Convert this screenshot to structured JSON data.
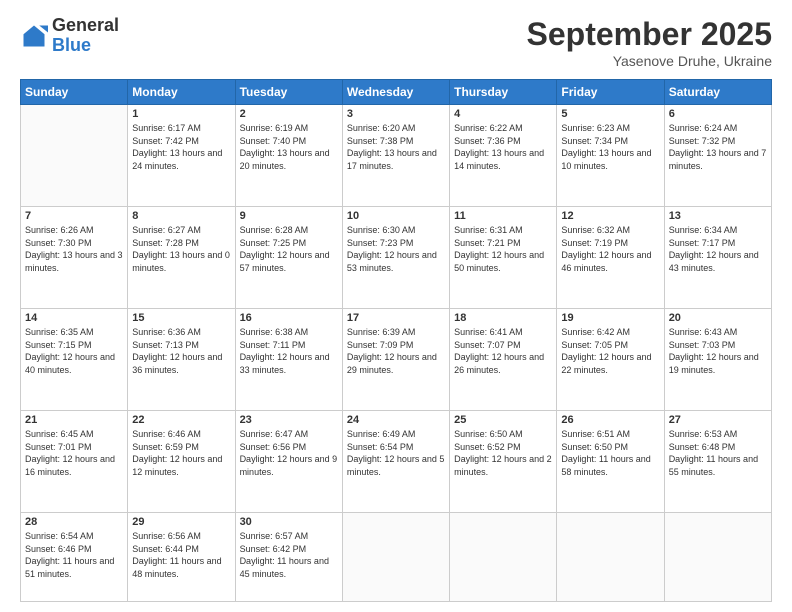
{
  "logo": {
    "general": "General",
    "blue": "Blue"
  },
  "header": {
    "month": "September 2025",
    "location": "Yasenove Druhe, Ukraine"
  },
  "weekdays": [
    "Sunday",
    "Monday",
    "Tuesday",
    "Wednesday",
    "Thursday",
    "Friday",
    "Saturday"
  ],
  "weeks": [
    [
      {
        "day": "",
        "info": ""
      },
      {
        "day": "1",
        "info": "Sunrise: 6:17 AM\nSunset: 7:42 PM\nDaylight: 13 hours and 24 minutes."
      },
      {
        "day": "2",
        "info": "Sunrise: 6:19 AM\nSunset: 7:40 PM\nDaylight: 13 hours and 20 minutes."
      },
      {
        "day": "3",
        "info": "Sunrise: 6:20 AM\nSunset: 7:38 PM\nDaylight: 13 hours and 17 minutes."
      },
      {
        "day": "4",
        "info": "Sunrise: 6:22 AM\nSunset: 7:36 PM\nDaylight: 13 hours and 14 minutes."
      },
      {
        "day": "5",
        "info": "Sunrise: 6:23 AM\nSunset: 7:34 PM\nDaylight: 13 hours and 10 minutes."
      },
      {
        "day": "6",
        "info": "Sunrise: 6:24 AM\nSunset: 7:32 PM\nDaylight: 13 hours and 7 minutes."
      }
    ],
    [
      {
        "day": "7",
        "info": "Sunrise: 6:26 AM\nSunset: 7:30 PM\nDaylight: 13 hours and 3 minutes."
      },
      {
        "day": "8",
        "info": "Sunrise: 6:27 AM\nSunset: 7:28 PM\nDaylight: 13 hours and 0 minutes."
      },
      {
        "day": "9",
        "info": "Sunrise: 6:28 AM\nSunset: 7:25 PM\nDaylight: 12 hours and 57 minutes."
      },
      {
        "day": "10",
        "info": "Sunrise: 6:30 AM\nSunset: 7:23 PM\nDaylight: 12 hours and 53 minutes."
      },
      {
        "day": "11",
        "info": "Sunrise: 6:31 AM\nSunset: 7:21 PM\nDaylight: 12 hours and 50 minutes."
      },
      {
        "day": "12",
        "info": "Sunrise: 6:32 AM\nSunset: 7:19 PM\nDaylight: 12 hours and 46 minutes."
      },
      {
        "day": "13",
        "info": "Sunrise: 6:34 AM\nSunset: 7:17 PM\nDaylight: 12 hours and 43 minutes."
      }
    ],
    [
      {
        "day": "14",
        "info": "Sunrise: 6:35 AM\nSunset: 7:15 PM\nDaylight: 12 hours and 40 minutes."
      },
      {
        "day": "15",
        "info": "Sunrise: 6:36 AM\nSunset: 7:13 PM\nDaylight: 12 hours and 36 minutes."
      },
      {
        "day": "16",
        "info": "Sunrise: 6:38 AM\nSunset: 7:11 PM\nDaylight: 12 hours and 33 minutes."
      },
      {
        "day": "17",
        "info": "Sunrise: 6:39 AM\nSunset: 7:09 PM\nDaylight: 12 hours and 29 minutes."
      },
      {
        "day": "18",
        "info": "Sunrise: 6:41 AM\nSunset: 7:07 PM\nDaylight: 12 hours and 26 minutes."
      },
      {
        "day": "19",
        "info": "Sunrise: 6:42 AM\nSunset: 7:05 PM\nDaylight: 12 hours and 22 minutes."
      },
      {
        "day": "20",
        "info": "Sunrise: 6:43 AM\nSunset: 7:03 PM\nDaylight: 12 hours and 19 minutes."
      }
    ],
    [
      {
        "day": "21",
        "info": "Sunrise: 6:45 AM\nSunset: 7:01 PM\nDaylight: 12 hours and 16 minutes."
      },
      {
        "day": "22",
        "info": "Sunrise: 6:46 AM\nSunset: 6:59 PM\nDaylight: 12 hours and 12 minutes."
      },
      {
        "day": "23",
        "info": "Sunrise: 6:47 AM\nSunset: 6:56 PM\nDaylight: 12 hours and 9 minutes."
      },
      {
        "day": "24",
        "info": "Sunrise: 6:49 AM\nSunset: 6:54 PM\nDaylight: 12 hours and 5 minutes."
      },
      {
        "day": "25",
        "info": "Sunrise: 6:50 AM\nSunset: 6:52 PM\nDaylight: 12 hours and 2 minutes."
      },
      {
        "day": "26",
        "info": "Sunrise: 6:51 AM\nSunset: 6:50 PM\nDaylight: 11 hours and 58 minutes."
      },
      {
        "day": "27",
        "info": "Sunrise: 6:53 AM\nSunset: 6:48 PM\nDaylight: 11 hours and 55 minutes."
      }
    ],
    [
      {
        "day": "28",
        "info": "Sunrise: 6:54 AM\nSunset: 6:46 PM\nDaylight: 11 hours and 51 minutes."
      },
      {
        "day": "29",
        "info": "Sunrise: 6:56 AM\nSunset: 6:44 PM\nDaylight: 11 hours and 48 minutes."
      },
      {
        "day": "30",
        "info": "Sunrise: 6:57 AM\nSunset: 6:42 PM\nDaylight: 11 hours and 45 minutes."
      },
      {
        "day": "",
        "info": ""
      },
      {
        "day": "",
        "info": ""
      },
      {
        "day": "",
        "info": ""
      },
      {
        "day": "",
        "info": ""
      }
    ]
  ]
}
